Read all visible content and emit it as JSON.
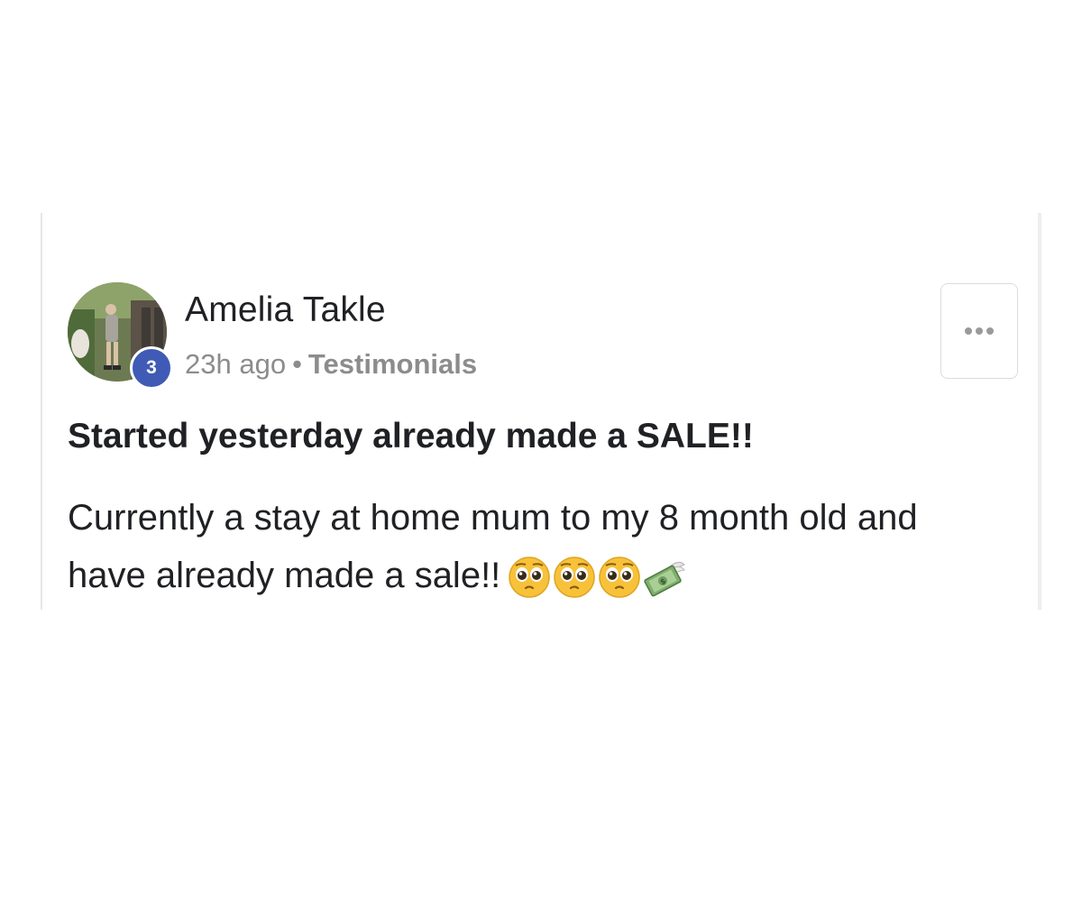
{
  "post": {
    "author": {
      "name": "Amelia Takle",
      "level": "3"
    },
    "time": "23h ago",
    "separator": "•",
    "category": "Testimonials",
    "title": "Started yesterday already made a SALE!!",
    "body_line1": "Currently a stay at home mum to my 8 month old and",
    "body_line2": "have already made a sale!!",
    "emojis": [
      "pleading-face-emoji",
      "pleading-face-emoji",
      "pleading-face-emoji",
      "money-with-wings-emoji"
    ]
  },
  "colors": {
    "badge": "#3f5bb5",
    "text": "#202124",
    "muted": "#8c8c8c"
  }
}
